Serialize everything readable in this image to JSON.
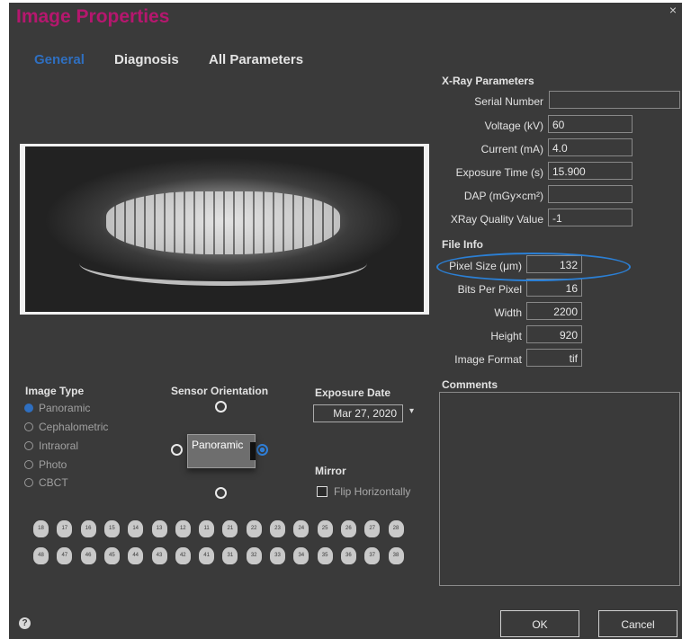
{
  "window": {
    "title": "Image Properties",
    "close_glyph": "×"
  },
  "tabs": [
    {
      "label": "General",
      "active": true
    },
    {
      "label": "Diagnosis",
      "active": false
    },
    {
      "label": "All Parameters",
      "active": false
    }
  ],
  "xray_parameters": {
    "heading": "X-Ray Parameters",
    "fields": [
      {
        "label": "Serial Number",
        "value": ""
      },
      {
        "label": "Voltage (kV)",
        "value": "60"
      },
      {
        "label": "Current (mA)",
        "value": "4.0"
      },
      {
        "label": "Exposure Time (s)",
        "value": "15.900"
      },
      {
        "label": "DAP (mGy×cm²)",
        "value": ""
      },
      {
        "label": "XRay Quality Value",
        "value": "-1"
      }
    ]
  },
  "file_info": {
    "heading": "File Info",
    "fields": [
      {
        "label": "Pixel Size (μm)",
        "value": "132"
      },
      {
        "label": "Bits Per Pixel",
        "value": "16"
      },
      {
        "label": "Width",
        "value": "2200"
      },
      {
        "label": "Height",
        "value": "920"
      },
      {
        "label": "Image Format",
        "value": "tif"
      }
    ]
  },
  "comments": {
    "heading": "Comments",
    "value": ""
  },
  "image_type": {
    "heading": "Image Type",
    "options": [
      "Panoramic",
      "Cephalometric",
      "Intraoral",
      "Photo",
      "CBCT"
    ],
    "selected": "Panoramic"
  },
  "sensor_orientation": {
    "heading": "Sensor Orientation",
    "label": "Panoramic",
    "selected": "right"
  },
  "exposure_date": {
    "heading": "Exposure Date",
    "value": "Mar 27, 2020",
    "arrow": "▾"
  },
  "mirror": {
    "heading": "Mirror",
    "checkbox_label": "Flip Horizontally",
    "checked": false
  },
  "teeth": {
    "upper": [
      "18",
      "17",
      "16",
      "15",
      "14",
      "13",
      "12",
      "11",
      "21",
      "22",
      "23",
      "24",
      "25",
      "26",
      "27",
      "28"
    ],
    "lower": [
      "48",
      "47",
      "46",
      "45",
      "44",
      "43",
      "42",
      "41",
      "31",
      "32",
      "33",
      "34",
      "35",
      "36",
      "37",
      "38"
    ]
  },
  "footer": {
    "help_glyph": "?",
    "ok_label": "OK",
    "cancel_label": "Cancel"
  },
  "colors": {
    "background": "#3a3a3a",
    "title": "#b5176e",
    "accent": "#2f6fc0",
    "highlight": "#2b7fd4"
  },
  "image": {
    "alt": "Panoramic dental X-ray"
  }
}
